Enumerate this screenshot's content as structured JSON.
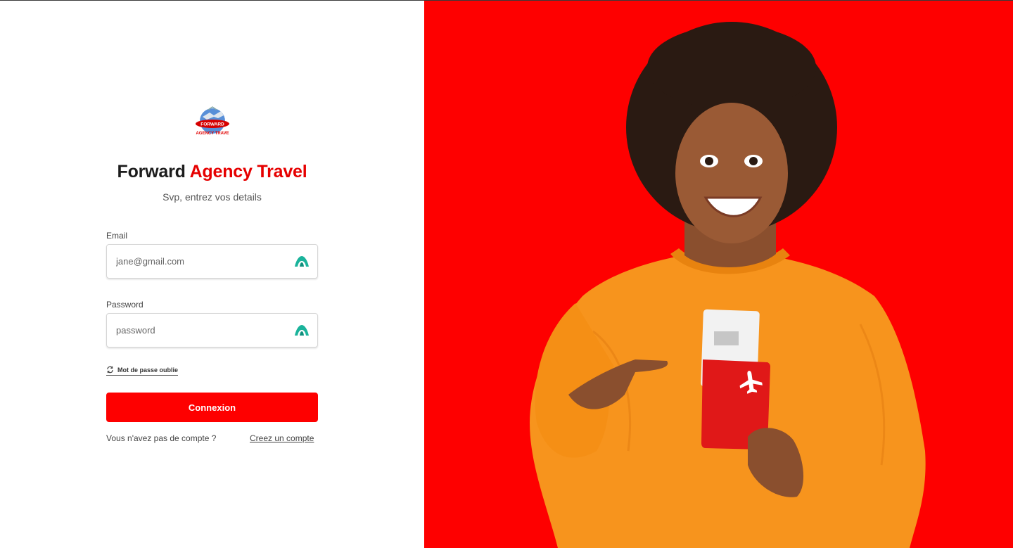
{
  "brand": {
    "title_main": "Forward",
    "title_accent": "Agency Travel",
    "subtitle": "Svp, entrez vos details",
    "logo_text_top": "FORWARD",
    "logo_text_bottom": "AGENCY TRAVE",
    "accent_color": "#fe0000"
  },
  "form": {
    "email": {
      "label": "Email",
      "placeholder": "jane@gmail.com",
      "value": "",
      "icon": "autofill-icon"
    },
    "password": {
      "label": "Password",
      "placeholder": "password",
      "value": "",
      "icon": "autofill-icon"
    },
    "forgot_label": "Mot de passe oublie",
    "forgot_icon": "refresh-icon",
    "submit_label": "Connexion",
    "no_account_text": "Vous n'avez pas de compte ?",
    "create_account_link": "Creez un compte"
  },
  "hero": {
    "background_color": "#fe0000",
    "image": "smiling woman in orange sweater holding red passport with boarding pass",
    "passport_icon": "airplane-icon"
  }
}
